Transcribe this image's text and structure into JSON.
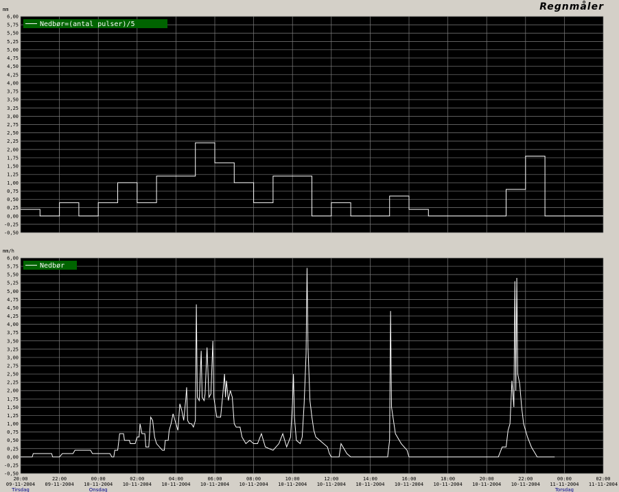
{
  "app": {
    "title": "Regnmåler"
  },
  "colors": {
    "background": "#000000",
    "grid": "#7f7f7f",
    "line1": "#ffffff",
    "line2": "#ffffff",
    "legend_bg": "#006400",
    "frame": "#d4d0c8"
  },
  "chart_data": [
    {
      "type": "line",
      "subtype": "step",
      "legend": "Nedbør=(antal pulser)/5",
      "unit": "mm",
      "ylim": [
        -0.5,
        6.0
      ],
      "yticks": [
        "6,00",
        "5,75",
        "5,50",
        "5,25",
        "5,00",
        "4,75",
        "4,50",
        "4,25",
        "4,00",
        "3,75",
        "3,50",
        "3,25",
        "3,00",
        "2,75",
        "2,50",
        "2,25",
        "2,00",
        "1,75",
        "1,50",
        "1,25",
        "1,00",
        "0,75",
        "0,50",
        "0,25",
        "0,00",
        "-0,25",
        "-0,50"
      ],
      "x_unit": "hours since 20:00 09-11-2004",
      "series": [
        {
          "points": [
            [
              0,
              0.2
            ],
            [
              1,
              0.0
            ],
            [
              2,
              0.4
            ],
            [
              3,
              0.0
            ],
            [
              4,
              0.4
            ],
            [
              5,
              1.0
            ],
            [
              6,
              0.4
            ],
            [
              7,
              1.2
            ],
            [
              8,
              1.2
            ],
            [
              9,
              2.2
            ],
            [
              10,
              1.6
            ],
            [
              11,
              1.0
            ],
            [
              12,
              0.4
            ],
            [
              13,
              1.2
            ],
            [
              14,
              1.2
            ],
            [
              15,
              0.0
            ],
            [
              16,
              0.4
            ],
            [
              17,
              0.0
            ],
            [
              18,
              0.0
            ],
            [
              19,
              0.6
            ],
            [
              20,
              0.2
            ],
            [
              21,
              0.0
            ],
            [
              22,
              0.0
            ],
            [
              23,
              0.0
            ],
            [
              24,
              0.0
            ],
            [
              25,
              0.8
            ],
            [
              26,
              1.8
            ],
            [
              27,
              0.0
            ],
            [
              30,
              0.0
            ]
          ]
        }
      ]
    },
    {
      "type": "line",
      "legend": "Nedbør",
      "unit": "mm/h",
      "ylim": [
        -0.5,
        6.0
      ],
      "yticks": [
        "6,00",
        "5,75",
        "5,50",
        "5,25",
        "5,00",
        "4,75",
        "4,50",
        "4,25",
        "4,00",
        "3,75",
        "3,50",
        "3,25",
        "3,00",
        "2,75",
        "2,50",
        "2,25",
        "2,00",
        "1,75",
        "1,50",
        "1,25",
        "1,00",
        "0,75",
        "0,50",
        "0,25",
        "0,00",
        "-0,25",
        "-0,50"
      ],
      "series": [
        {
          "points": [
            [
              0,
              0
            ],
            [
              0.6,
              0
            ],
            [
              0.65,
              0.1
            ],
            [
              1.6,
              0.1
            ],
            [
              1.65,
              0
            ],
            [
              2,
              0
            ],
            [
              2.15,
              0.1
            ],
            [
              2.7,
              0.1
            ],
            [
              2.8,
              0.2
            ],
            [
              3.6,
              0.2
            ],
            [
              3.7,
              0.1
            ],
            [
              4.6,
              0.1
            ],
            [
              4.7,
              0
            ],
            [
              4.8,
              0
            ],
            [
              4.85,
              0.2
            ],
            [
              5.0,
              0.2
            ],
            [
              5.1,
              0.7
            ],
            [
              5.3,
              0.7
            ],
            [
              5.35,
              0.5
            ],
            [
              5.6,
              0.5
            ],
            [
              5.65,
              0.4
            ],
            [
              5.9,
              0.4
            ],
            [
              6.0,
              0.6
            ],
            [
              6.1,
              0.6
            ],
            [
              6.15,
              1.0
            ],
            [
              6.25,
              0.7
            ],
            [
              6.4,
              0.7
            ],
            [
              6.45,
              0.3
            ],
            [
              6.6,
              0.3
            ],
            [
              6.7,
              1.2
            ],
            [
              6.8,
              1.1
            ],
            [
              6.9,
              0.6
            ],
            [
              7.0,
              0.4
            ],
            [
              7.3,
              0.2
            ],
            [
              7.4,
              0.2
            ],
            [
              7.45,
              0.5
            ],
            [
              7.6,
              0.5
            ],
            [
              7.65,
              0.8
            ],
            [
              7.75,
              1.0
            ],
            [
              7.85,
              1.3
            ],
            [
              8.0,
              1.0
            ],
            [
              8.1,
              0.8
            ],
            [
              8.2,
              1.6
            ],
            [
              8.3,
              1.4
            ],
            [
              8.4,
              1.1
            ],
            [
              8.5,
              1.7
            ],
            [
              8.55,
              2.1
            ],
            [
              8.6,
              1.1
            ],
            [
              8.7,
              1.0
            ],
            [
              8.8,
              1.0
            ],
            [
              8.9,
              0.9
            ],
            [
              9.0,
              1.1
            ],
            [
              9.05,
              4.6
            ],
            [
              9.1,
              1.8
            ],
            [
              9.2,
              1.7
            ],
            [
              9.3,
              3.2
            ],
            [
              9.35,
              1.8
            ],
            [
              9.45,
              1.7
            ],
            [
              9.5,
              1.9
            ],
            [
              9.6,
              3.3
            ],
            [
              9.7,
              1.8
            ],
            [
              9.8,
              1.9
            ],
            [
              9.9,
              3.5
            ],
            [
              9.95,
              1.8
            ],
            [
              10.1,
              1.2
            ],
            [
              10.3,
              1.2
            ],
            [
              10.4,
              1.8
            ],
            [
              10.5,
              2.5
            ],
            [
              10.55,
              1.8
            ],
            [
              10.6,
              2.3
            ],
            [
              10.7,
              1.7
            ],
            [
              10.8,
              2.0
            ],
            [
              10.9,
              1.8
            ],
            [
              11.0,
              1.0
            ],
            [
              11.1,
              0.9
            ],
            [
              11.3,
              0.9
            ],
            [
              11.4,
              0.6
            ],
            [
              11.6,
              0.4
            ],
            [
              11.8,
              0.5
            ],
            [
              12.0,
              0.4
            ],
            [
              12.2,
              0.4
            ],
            [
              12.4,
              0.7
            ],
            [
              12.6,
              0.3
            ],
            [
              13.0,
              0.2
            ],
            [
              13.3,
              0.4
            ],
            [
              13.5,
              0.7
            ],
            [
              13.7,
              0.3
            ],
            [
              13.9,
              0.6
            ],
            [
              14.0,
              1.6
            ],
            [
              14.05,
              2.5
            ],
            [
              14.1,
              1.2
            ],
            [
              14.2,
              0.5
            ],
            [
              14.4,
              0.4
            ],
            [
              14.5,
              0.6
            ],
            [
              14.6,
              1.6
            ],
            [
              14.7,
              3.1
            ],
            [
              14.75,
              5.7
            ],
            [
              14.8,
              3.3
            ],
            [
              14.9,
              1.7
            ],
            [
              15.0,
              1.2
            ],
            [
              15.1,
              0.8
            ],
            [
              15.2,
              0.6
            ],
            [
              15.4,
              0.5
            ],
            [
              15.6,
              0.4
            ],
            [
              15.8,
              0.3
            ],
            [
              15.9,
              0.1
            ],
            [
              16.0,
              0
            ],
            [
              16.4,
              0
            ],
            [
              16.5,
              0.4
            ],
            [
              16.6,
              0.3
            ],
            [
              16.8,
              0.1
            ],
            [
              17.0,
              0
            ],
            [
              18.0,
              0
            ],
            [
              18.9,
              0
            ],
            [
              19.0,
              0.5
            ],
            [
              19.05,
              4.4
            ],
            [
              19.1,
              1.5
            ],
            [
              19.3,
              0.7
            ],
            [
              19.6,
              0.4
            ],
            [
              19.9,
              0.2
            ],
            [
              20.0,
              0
            ],
            [
              20.1,
              0
            ],
            [
              24.6,
              0
            ],
            [
              24.8,
              0.3
            ],
            [
              25.0,
              0.3
            ],
            [
              25.1,
              0.8
            ],
            [
              25.2,
              1.0
            ],
            [
              25.3,
              2.3
            ],
            [
              25.4,
              1.5
            ],
            [
              25.45,
              5.3
            ],
            [
              25.5,
              2.0
            ],
            [
              25.55,
              5.4
            ],
            [
              25.6,
              2.5
            ],
            [
              25.7,
              2.2
            ],
            [
              25.8,
              1.5
            ],
            [
              25.9,
              1.0
            ],
            [
              26.1,
              0.6
            ],
            [
              26.3,
              0.3
            ],
            [
              26.5,
              0.1
            ],
            [
              26.6,
              0
            ],
            [
              27.5,
              0
            ]
          ]
        }
      ]
    }
  ],
  "x_axis": {
    "ticks": [
      {
        "time": "20:00",
        "date": "09-11-2004",
        "day": "Tirsdag"
      },
      {
        "time": "22:00",
        "date": "09-11-2004",
        "day": ""
      },
      {
        "time": "00:00",
        "date": "10-11-2004",
        "day": "Onsdag"
      },
      {
        "time": "02:00",
        "date": "10-11-2004",
        "day": ""
      },
      {
        "time": "04:00",
        "date": "10-11-2004",
        "day": ""
      },
      {
        "time": "06:00",
        "date": "10-11-2004",
        "day": ""
      },
      {
        "time": "08:00",
        "date": "10-11-2004",
        "day": ""
      },
      {
        "time": "10:00",
        "date": "10-11-2004",
        "day": ""
      },
      {
        "time": "12:00",
        "date": "10-11-2004",
        "day": ""
      },
      {
        "time": "14:00",
        "date": "10-11-2004",
        "day": ""
      },
      {
        "time": "16:00",
        "date": "10-11-2004",
        "day": ""
      },
      {
        "time": "18:00",
        "date": "10-11-2004",
        "day": ""
      },
      {
        "time": "20:00",
        "date": "10-11-2004",
        "day": ""
      },
      {
        "time": "22:00",
        "date": "10-11-2004",
        "day": ""
      },
      {
        "time": "00:00",
        "date": "11-11-2004",
        "day": "Torsdag"
      },
      {
        "time": "02:00",
        "date": "11-11-2004",
        "day": ""
      }
    ]
  }
}
